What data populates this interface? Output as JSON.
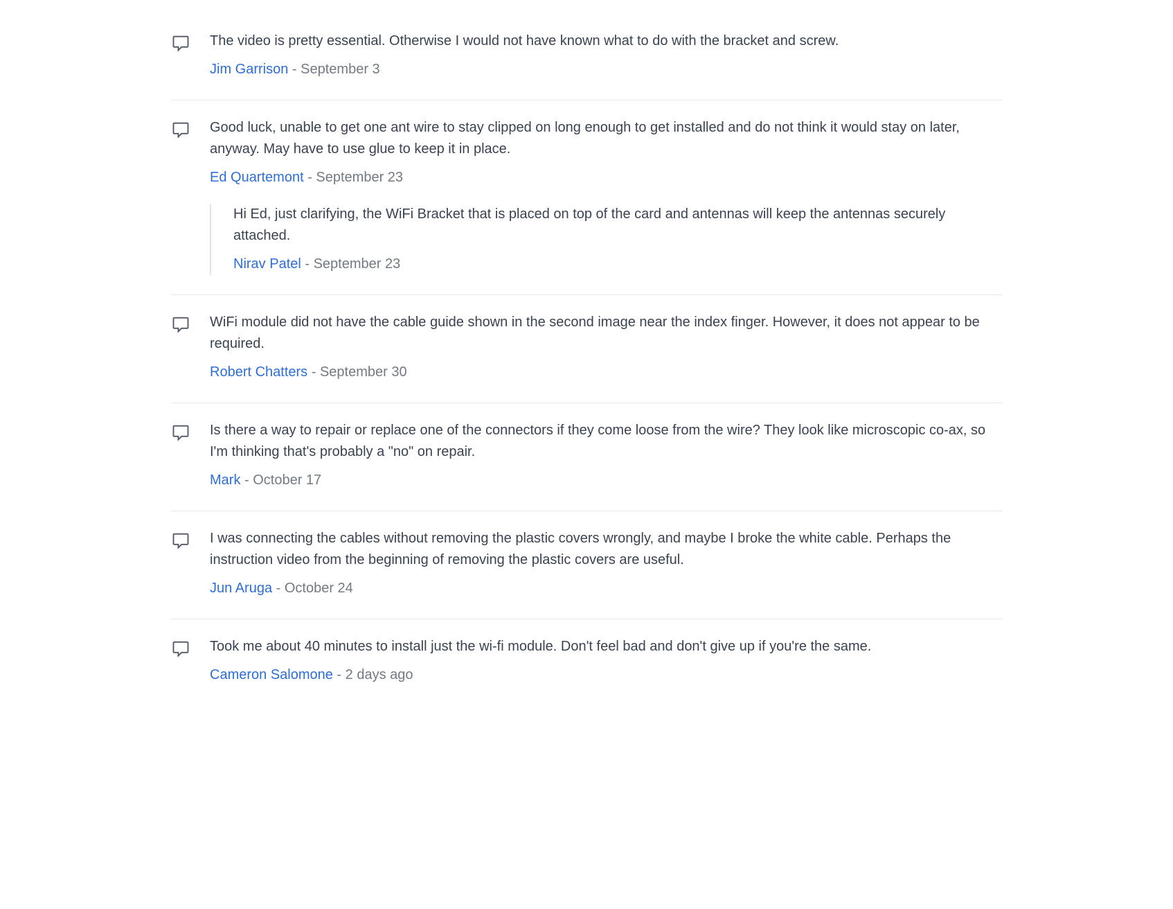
{
  "comments": [
    {
      "text": "The video is pretty essential. Otherwise I would not have known what to do with the bracket and screw.",
      "author": "Jim Garrison",
      "date": "September 3",
      "replies": []
    },
    {
      "text": "Good luck, unable to get one ant wire to stay clipped on long enough to get installed and do not think it would stay on later, anyway. May have to use glue to keep it in place.",
      "author": "Ed Quartemont",
      "date": "September 23",
      "replies": [
        {
          "text": "Hi Ed, just clarifying, the WiFi Bracket that is placed on top of the card and antennas will keep the antennas securely attached.",
          "author": "Nirav Patel",
          "date": "September 23"
        }
      ]
    },
    {
      "text": "WiFi module did not have the cable guide shown in the second image near the index finger. However, it does not appear to be required.",
      "author": "Robert Chatters",
      "date": "September 30",
      "replies": []
    },
    {
      "text": "Is there a way to repair or replace one of the connectors if they come loose from the wire? They look like microscopic co-ax, so I'm thinking that's probably a \"no\" on repair.",
      "author": "Mark",
      "date": "October 17",
      "replies": []
    },
    {
      "text": "I was connecting the cables without removing the plastic covers wrongly, and maybe I broke the white cable. Perhaps the instruction video from the beginning of removing the plastic covers are useful.",
      "author": "Jun Aruga",
      "date": "October 24",
      "replies": []
    },
    {
      "text": "Took me about 40 minutes to install just the wi-fi module. Don't feel bad and don't give up if you're the same.",
      "author": "Cameron Salomone",
      "date": "2 days ago",
      "replies": []
    }
  ],
  "separator": " - "
}
